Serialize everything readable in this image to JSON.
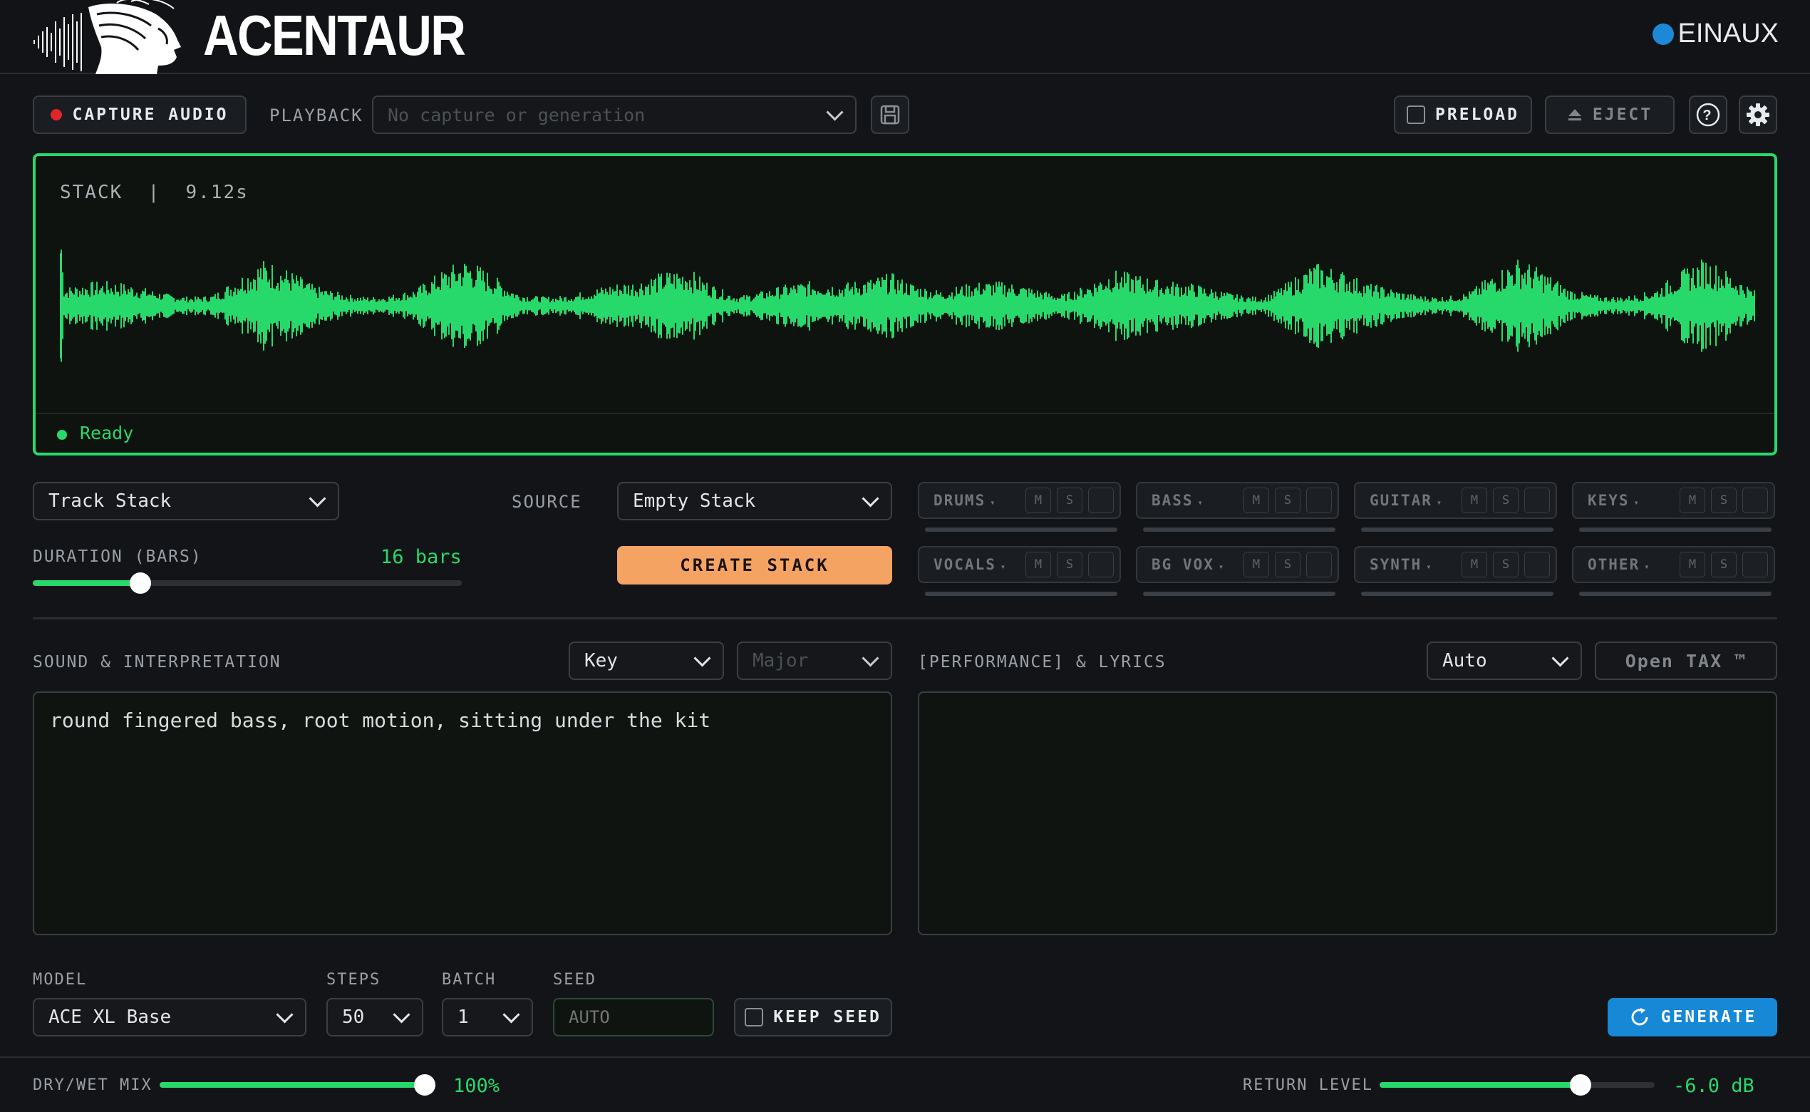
{
  "header": {
    "app_title": "ACENTAUR",
    "brand": "EINAUX"
  },
  "toolbar": {
    "capture_label": "CAPTURE AUDIO",
    "playback_label": "PLAYBACK",
    "playback_placeholder": "No capture or generation",
    "preload_label": "PRELOAD",
    "eject_label": "EJECT"
  },
  "wave": {
    "title": "STACK  |  9.12s",
    "status": "Ready",
    "color": "#27d96a"
  },
  "stack": {
    "mode_value": "Track Stack",
    "source_label": "SOURCE",
    "source_value": "Empty Stack",
    "duration_label": "DURATION (BARS)",
    "duration_value": "16 bars",
    "duration_fraction": 0.25,
    "create_label": "CREATE STACK"
  },
  "stems": [
    {
      "name": "DRUMS"
    },
    {
      "name": "BASS"
    },
    {
      "name": "GUITAR"
    },
    {
      "name": "KEYS"
    },
    {
      "name": "VOCALS"
    },
    {
      "name": "BG VOX"
    },
    {
      "name": "SYNTH"
    },
    {
      "name": "OTHER"
    }
  ],
  "stem_buttons": {
    "mute": "M",
    "solo": "S"
  },
  "sound": {
    "label": "SOUND & INTERPRETATION",
    "key_value": "Key",
    "scale_value": "Major",
    "text": "round fingered bass, root motion, sitting under the kit"
  },
  "lyrics": {
    "label": "[PERFORMANCE] & LYRICS",
    "mode_value": "Auto",
    "open_tax_label": "Open TAX ™",
    "text": ""
  },
  "gen": {
    "model_label": "MODEL",
    "model_value": "ACE XL Base",
    "steps_label": "STEPS",
    "steps_value": "50",
    "batch_label": "BATCH",
    "batch_value": "1",
    "seed_label": "SEED",
    "seed_placeholder": "AUTO",
    "keep_seed_label": "KEEP SEED",
    "generate_label": "GENERATE"
  },
  "footer": {
    "dry_wet_label": "DRY/WET MIX",
    "dry_wet_value": "100%",
    "dry_wet_fraction": 1.0,
    "return_label": "RETURN LEVEL",
    "return_value": "-6.0 dB",
    "return_fraction": 0.73
  },
  "colors": {
    "accent_green": "#27d96a",
    "create_orange": "#f5a363",
    "generate_blue": "#1688d6",
    "record_red": "#e0262b"
  }
}
